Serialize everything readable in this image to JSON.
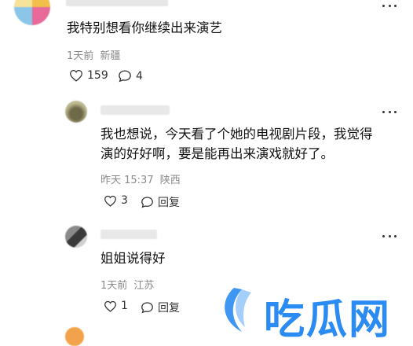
{
  "comments": [
    {
      "text": "我特别想看你继续出来演艺",
      "time": "1天前",
      "location": "新疆",
      "likes": "159",
      "replies": "4"
    },
    {
      "text_line1": "我也想说，今天看了个她的电视剧片段，我觉得",
      "text_line2": "演的好好啊，要是能再出来演戏就好了。",
      "time": "昨天 15:37",
      "location": "陕西",
      "likes": "3",
      "reply_label": "回复"
    },
    {
      "text": "姐姐说得好",
      "time": "1天前",
      "location": "江苏",
      "likes": "1",
      "reply_label": "回复"
    }
  ],
  "watermark": {
    "text": "吃瓜网",
    "color": "#2a8bf2"
  },
  "icons": [
    "heart-icon",
    "comment-icon",
    "more-icon"
  ]
}
